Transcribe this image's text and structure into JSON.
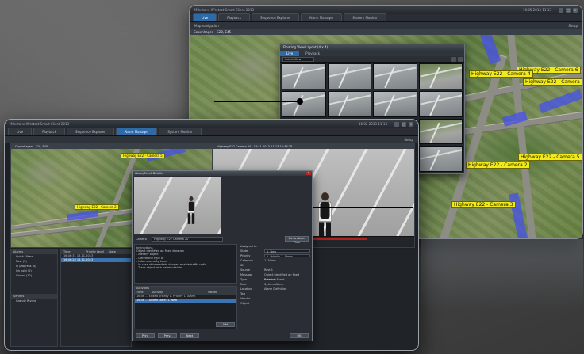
{
  "back_window": {
    "title": "Milestone XProtect Smart Client 2013",
    "clock": "16:05 2013-11-13",
    "tabs": [
      "Live",
      "Playback",
      "Sequence Explorer",
      "Alarm Manager",
      "System Monitor"
    ],
    "active_tab": 0,
    "subbar": "Map navigation",
    "setup": "Setup",
    "map_title": "Copenhagen - E20, E45",
    "camera_labels": [
      "Highway E22 - Camera 6",
      "Highway E22 - Camera 7",
      "Highway E22 - Camera 5",
      "Highway E22 - Camera 2",
      "Highway E22 - Camera 3",
      "Highway E22 - Camera 4"
    ]
  },
  "camera_dialog": {
    "title": "Floating View Layout (4 x 4)",
    "tabs": [
      "Live",
      "Playback"
    ],
    "selector": "Select View"
  },
  "front_window": {
    "title": "Milestone XProtect Smart Client 2013",
    "clock": "16:02 2013-11-13",
    "tabs": [
      "Live",
      "Playback",
      "Sequence Explorer",
      "Alarm Manager",
      "System Monitor"
    ],
    "active_tab": 3,
    "setup": "Setup",
    "map_title": "Copenhagen - E20, E45",
    "video_title": "Highway E22 Camera 20 - 16:41 2013-11-13 16:46:28",
    "timestamp": "16:46 2013-11-13",
    "camera_labels": [
      "Highway E22 - Camera 5",
      "Highway E22 - Camera 2"
    ],
    "side_panel": {
      "alarms_header": "Alarms",
      "quick_filters_header": "Quick Filters",
      "filters": [
        "New (3)",
        "In progress (0)",
        "On hold (0)",
        "Closed (12)"
      ],
      "servers_header": "Servers",
      "server": "Grande Rivière"
    },
    "alarm_list": {
      "headers": [
        "Time",
        "Priority Level",
        "State"
      ],
      "rows": [
        "16:46:31 13-11-2013",
        "16:46:28 13-11-2013"
      ],
      "selected": 1
    }
  },
  "popup": {
    "title": "Alarm/Event Details",
    "close": "×",
    "camera_label": "Camera",
    "camera_value": "Highway E22 Camera 20",
    "goto_button": "Go to Alarm Time",
    "instructions_title": "Instructions",
    "instructions": [
      "Object identified on fixed duration",
      "- Identify object",
      "- Determine type of",
      "- Inform security team",
      "- In case of immediate danger: enable traffic radio",
      "- Track object with patrol vehicle"
    ],
    "properties": [
      {
        "k": "Assigned to",
        "v": ""
      },
      {
        "k": "State",
        "v": "1. New"
      },
      {
        "k": "Priority",
        "v": "1. Priority 1. Alarm"
      },
      {
        "k": "Category",
        "v": "1. Alarm"
      },
      {
        "k": "ID",
        "v": ""
      },
      {
        "k": "Source",
        "v": "Rest 1"
      },
      {
        "k": "Message",
        "v": "Object identified on fixed duration"
      },
      {
        "k": "Type",
        "v": "External Event"
      },
      {
        "k": "Rule",
        "v": "System Alarm"
      },
      {
        "k": "Location",
        "v": "Alarm Definition"
      },
      {
        "k": "Tag",
        "v": ""
      },
      {
        "k": "Vendor",
        "v": ""
      },
      {
        "k": "Object",
        "v": ""
      }
    ],
    "activities_title": "Activities",
    "activities_headers": [
      "Time",
      "Activity",
      "Owner"
    ],
    "activities": [
      "16:46 ... Edited priority 1. Priority 1. Alarm",
      "16:46 ... Added state: 1. New"
    ],
    "add_button": "Add",
    "footer": [
      "Print",
      "Prev.",
      "Next",
      "OK"
    ]
  },
  "colors": {
    "accent": "#2e6aa8",
    "camera_zone": "#4650eb",
    "camera_label": "#f2ea18"
  }
}
